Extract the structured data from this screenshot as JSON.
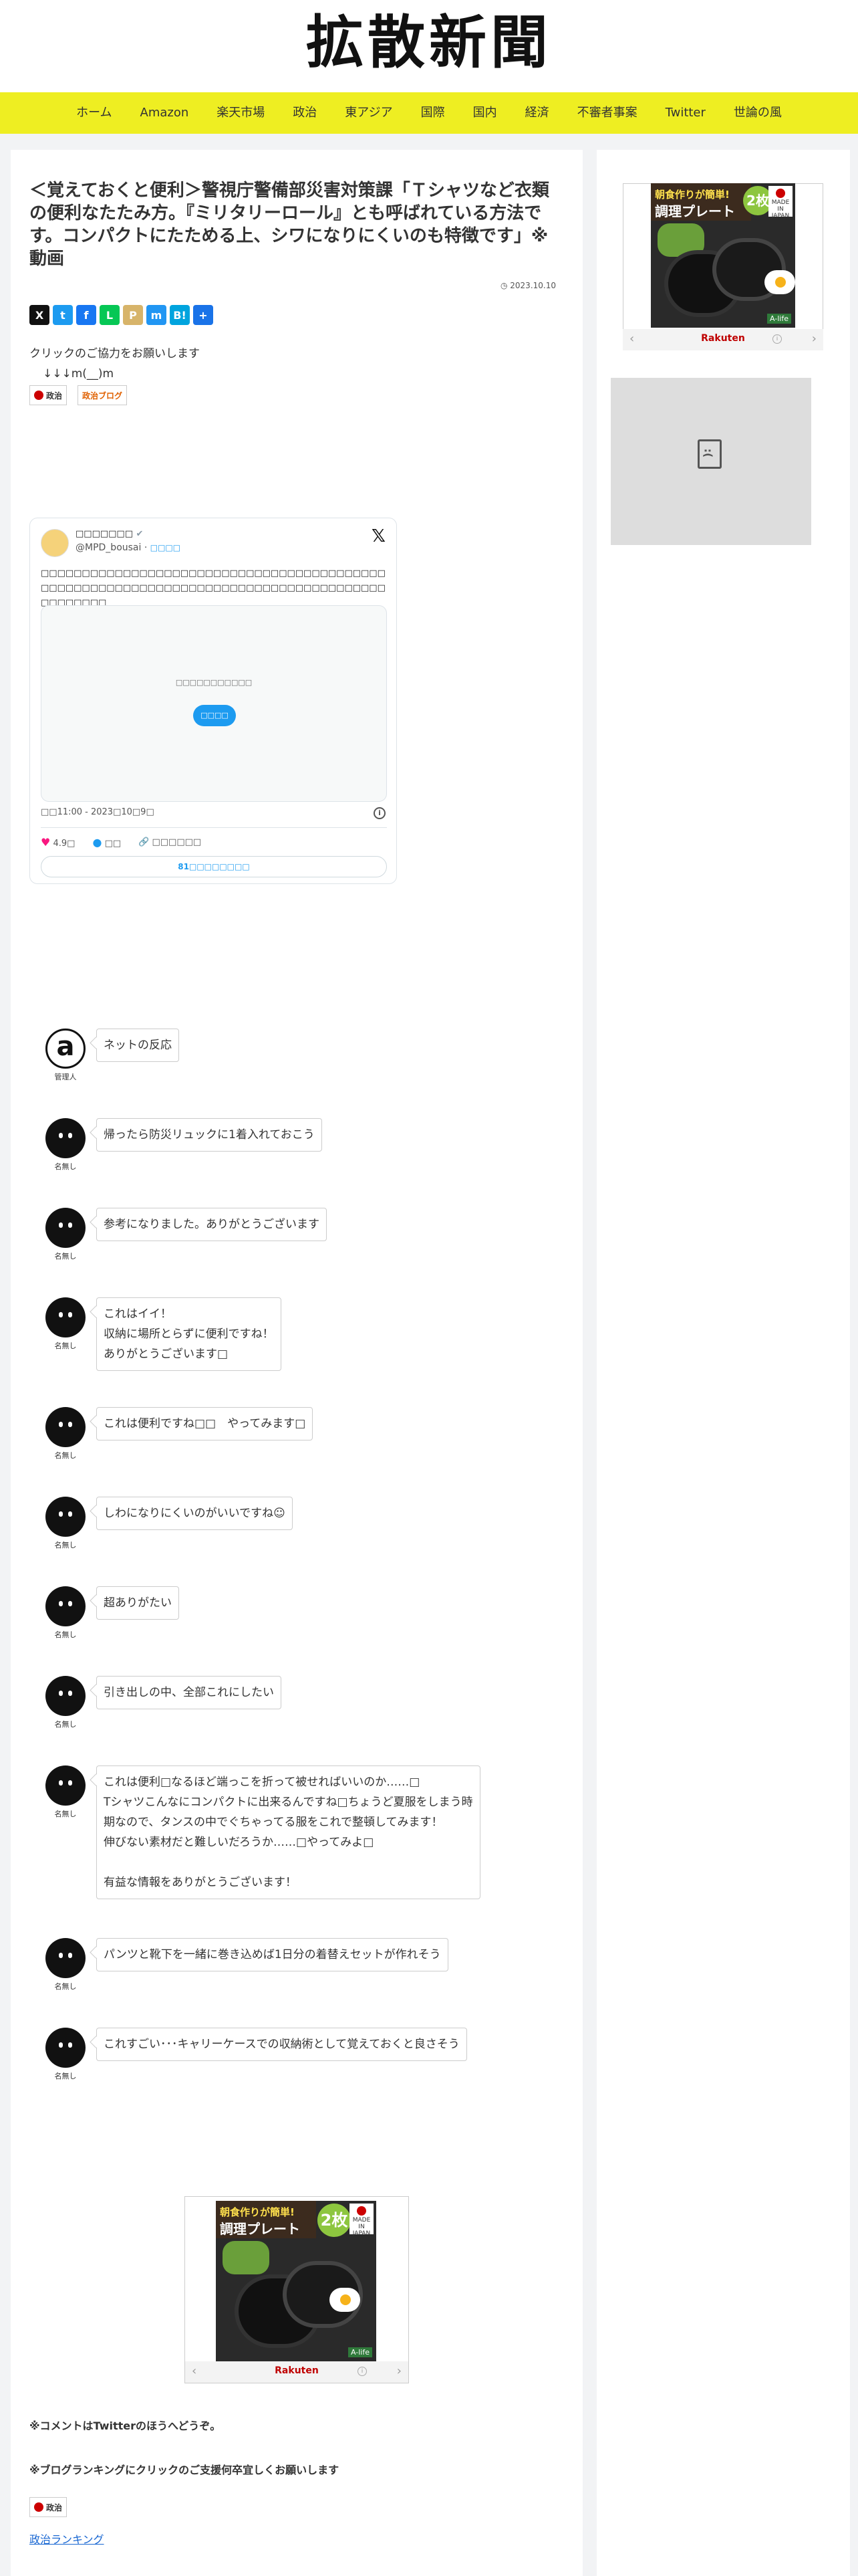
{
  "site": {
    "logo": "拡散新聞"
  },
  "nav": {
    "items": [
      "ホーム",
      "Amazon",
      "楽天市場",
      "政治",
      "東アジア",
      "国際",
      "国内",
      "経済",
      "不審者事案",
      "Twitter",
      "世論の風"
    ]
  },
  "article": {
    "title": "＜覚えておくと便利＞警視庁警備部災害対策課「Ｔシャツなど衣類の便利なたたみ方。『ミリタリーロール』とも呼ばれている方法です。コンパクトにたためる上、シワになりにくいのも特徴です」※動画",
    "date": "2023.10.10",
    "coop_line1": "クリックのご協力をお願いします",
    "coop_line2": "↓↓↓m(__)m",
    "badge_politics": "政治",
    "badge_blog": "政治ブログ",
    "share_icons": [
      "x-icon",
      "twitter-icon",
      "facebook-icon",
      "line-icon",
      "pocket-icon",
      "messenger-icon",
      "hatena-icon",
      "plus-icon"
    ]
  },
  "tweet": {
    "display_name": "□□□□□□□",
    "handle": "@MPD_bousai · ",
    "follow": "□□□□",
    "text": "□□□□□□□□□□□□□□□□□□□□□□□□□□□□□□□□□□□□□□□□□□□□□□□□□□□□□□□□□□□□□□□□□□□□□□□□□□□□□□□□□□□□□□□□□□□□",
    "media_message": "□□□□□□□□□□□",
    "media_button": "□□□□",
    "time": "□□11:00 - 2023□10□9□",
    "likes": "4.9□",
    "reply_label": "□□",
    "copy_label": "□□□□□□",
    "read_replies": "81□□□□□□□□"
  },
  "comments": [
    {
      "name": "管理人",
      "text": "ネットの反応",
      "admin": true
    },
    {
      "name": "名無し",
      "text": "帰ったら防災リュックに1着入れておこう"
    },
    {
      "name": "名無し",
      "text": "参考になりました。ありがとうございます"
    },
    {
      "name": "名無し",
      "text": "これはイイ！\n収納に場所とらずに便利ですね！\nありがとうございます□"
    },
    {
      "name": "名無し",
      "text": "これは便利ですね□□　やってみます□"
    },
    {
      "name": "名無し",
      "text": "しわになりにくいのがいいですね☺"
    },
    {
      "name": "名無し",
      "text": "超ありがたい"
    },
    {
      "name": "名無し",
      "text": "引き出しの中、全部これにしたい"
    },
    {
      "name": "名無し",
      "text": "これは便利□なるほど端っこを折って被せればいいのか……□\nTシャツこんなにコンパクトに出来るんですね□ちょうど夏服をしまう時\n期なので、タンスの中でぐちゃってる服をこれで整頓してみます！\n伸びない素材だと難しいだろうか……□やってみよ□\n\n有益な情報をありがとうございます！"
    },
    {
      "name": "名無し",
      "text": "パンツと靴下を一緒に巻き込めば1日分の着替えセットが作れそう"
    },
    {
      "name": "名無し",
      "text": "これすごい･･･キャリーケースでの収納術として覚えておくと良さそう"
    }
  ],
  "ad": {
    "headline": "朝食作りが簡単!",
    "product": "調理プレート",
    "badge": "2枚",
    "made_in": "MADE IN JAPAN",
    "brand": "A-life",
    "footer_brand": "Rakuten"
  },
  "footer": {
    "note1": "※コメントはTwitterのほうへどうぞ。",
    "note2": "※ブログランキングにクリックのご支援何卒宜しくお願いします",
    "rank_link": "政治ランキング"
  },
  "colors": {
    "nav_bg": "#eeee22",
    "body_bg": "#f2f3f5",
    "twitter_blue": "#1d9bf0",
    "like_pink": "#f91880",
    "rakuten_red": "#bf0000"
  }
}
